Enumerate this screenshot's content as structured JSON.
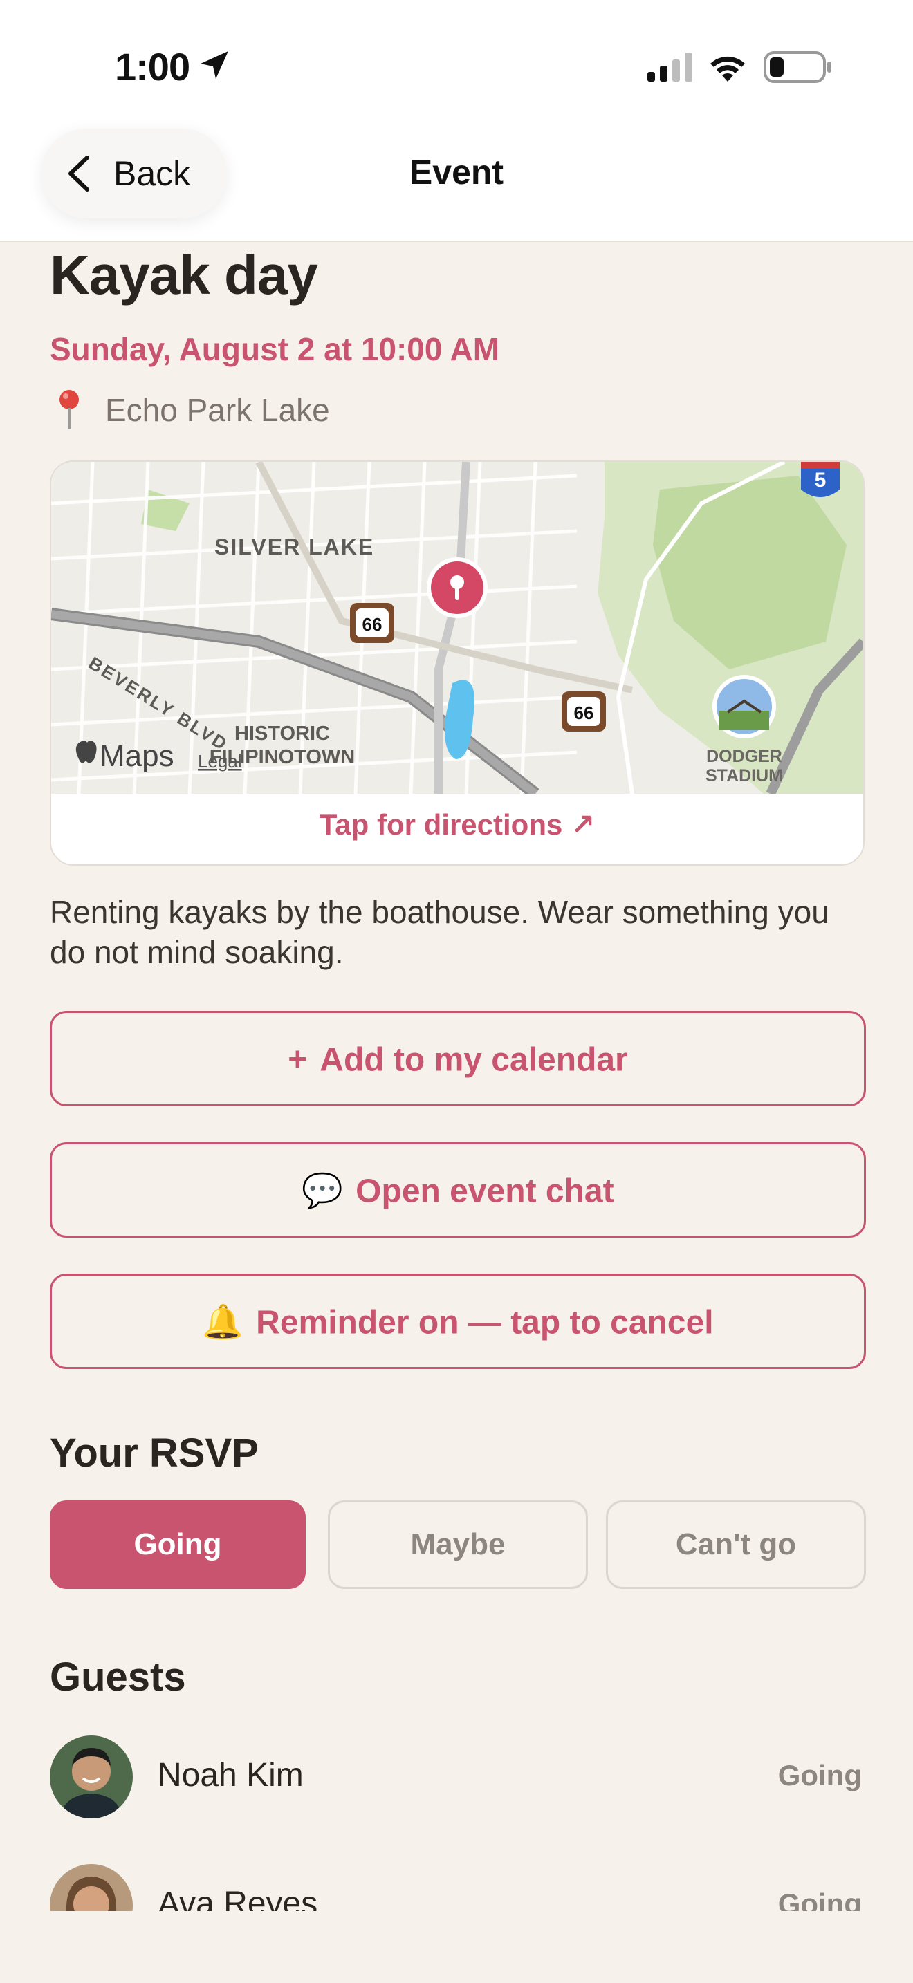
{
  "status_bar": {
    "time": "1:00"
  },
  "nav": {
    "back_label": "Back",
    "title": "Event"
  },
  "event": {
    "title": "Kayak day",
    "date": "Sunday, August 2 at 10:00 AM",
    "location": "Echo Park Lake",
    "description": "Renting kayaks by the boathouse. Wear something you do not mind soaking."
  },
  "map": {
    "labels": {
      "silver_lake": "SILVER LAKE",
      "historic_filipinotown_1": "HISTORIC",
      "historic_filipinotown_2": "FILIPINOTOWN",
      "beverly_blvd": "BEVERLY BLVD",
      "dodger_stadium_1": "DODGER",
      "dodger_stadium_2": "STADIUM",
      "route_66": "66",
      "interstate_5": "5",
      "maps_brand": "Maps",
      "legal": "Legal"
    },
    "directions_label": "Tap for directions ↗"
  },
  "actions": {
    "add_calendar": {
      "icon": "+",
      "label": "Add to my calendar"
    },
    "open_chat": {
      "icon": "💬",
      "label": "Open event chat"
    },
    "reminder": {
      "icon": "🔔",
      "label": "Reminder on — tap to cancel"
    }
  },
  "rsvp": {
    "heading": "Your RSVP",
    "options": [
      "Going",
      "Maybe",
      "Can't go"
    ],
    "selected": "Going"
  },
  "guests": {
    "heading": "Guests",
    "list": [
      {
        "name": "Noah Kim",
        "status": "Going"
      },
      {
        "name": "Ava Reyes",
        "status": "Going"
      }
    ]
  },
  "colors": {
    "accent": "#c85470",
    "background": "#f6f1ea",
    "text": "#2b2522",
    "muted": "#8d857f"
  }
}
